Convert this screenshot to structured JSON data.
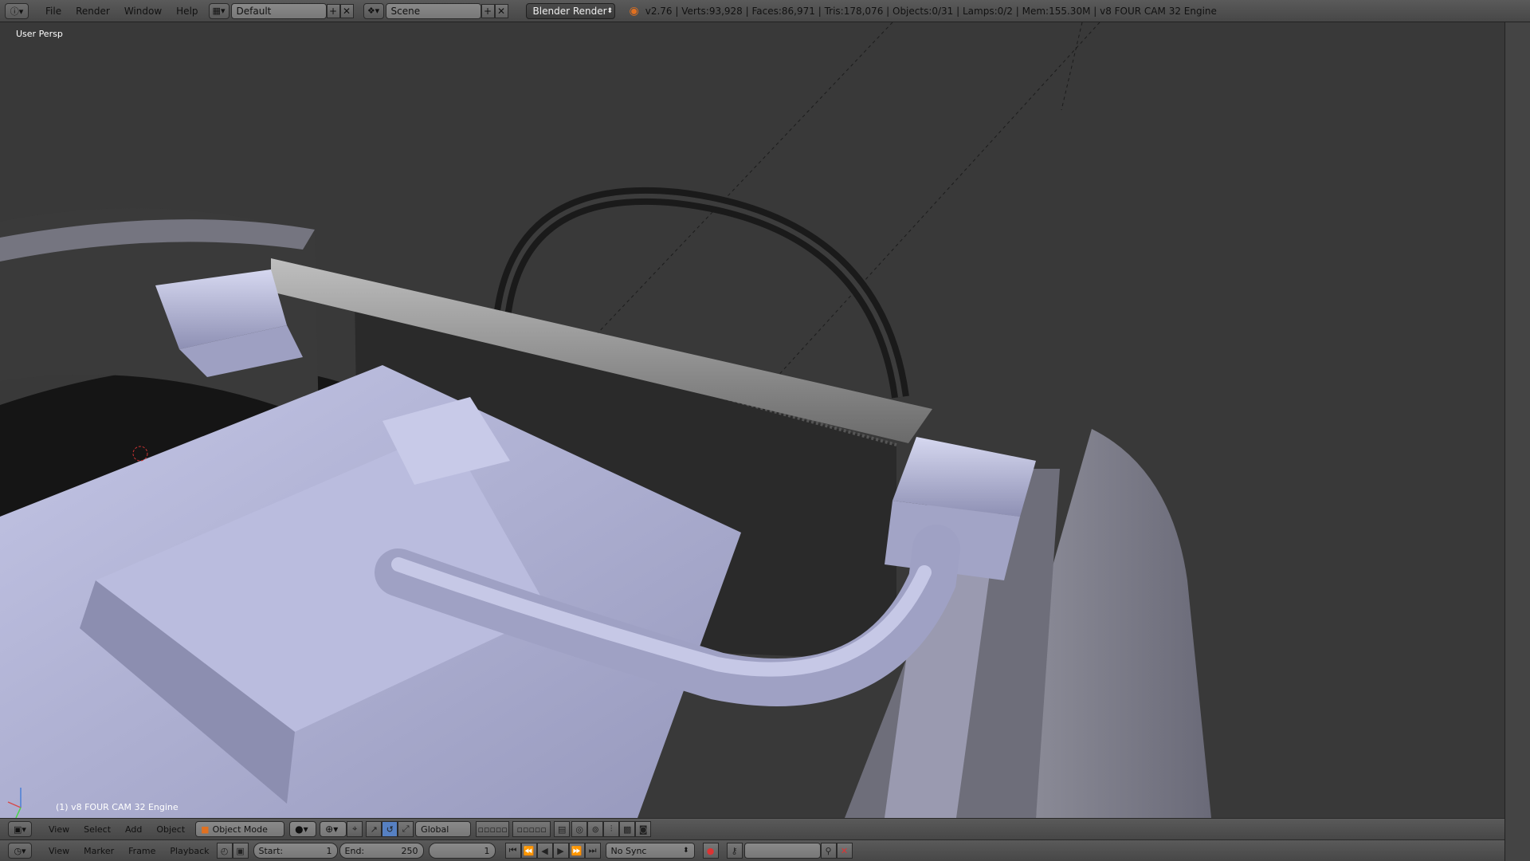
{
  "topbar": {
    "menus": [
      "File",
      "Render",
      "Window",
      "Help"
    ],
    "screen_layout": "Default",
    "scene": "Scene",
    "render_engine": "Blender Render",
    "stats": "v2.76 | Verts:93,928 | Faces:86,971 | Tris:178,076 | Objects:0/31 | Lamps:0/2 | Mem:155.30M | v8 FOUR CAM 32 Engine"
  },
  "viewport": {
    "view_label": "User Persp",
    "object_label": "(1) v8 FOUR CAM 32 Engine"
  },
  "view3d_header": {
    "menus": [
      "View",
      "Select",
      "Add",
      "Object"
    ],
    "mode": "Object Mode",
    "orientation": "Global"
  },
  "timeline": {
    "menus": [
      "View",
      "Marker",
      "Frame",
      "Playback"
    ],
    "start_label": "Start:",
    "start_value": "1",
    "end_label": "End:",
    "end_value": "250",
    "current_frame": "1",
    "sync": "No Sync"
  },
  "colors": {
    "background": "#393939",
    "header": "#505050",
    "mesh": "#b4b6d8",
    "accent": "#e07020"
  }
}
